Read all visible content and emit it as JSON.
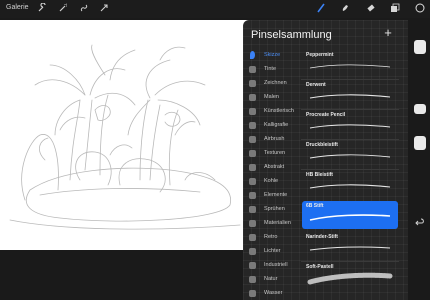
{
  "topbar": {
    "gallery_label": "Galerie",
    "tools": [
      {
        "icon": "wrench-icon"
      },
      {
        "icon": "magic-wand-icon"
      },
      {
        "icon": "selection-icon"
      },
      {
        "icon": "arrow-cursor-icon"
      }
    ],
    "right_tools": [
      {
        "icon": "brush-icon",
        "active": true
      },
      {
        "icon": "smudge-icon"
      },
      {
        "icon": "eraser-icon"
      },
      {
        "icon": "layers-icon"
      },
      {
        "icon": "color-icon"
      }
    ],
    "accent": "#3b82f6"
  },
  "panel": {
    "title": "Pinselsammlung",
    "add_label": "+",
    "categories": [
      {
        "label": "Skizze",
        "active": true
      },
      {
        "label": "Tinte"
      },
      {
        "label": "Zeichnen"
      },
      {
        "label": "Malen"
      },
      {
        "label": "Künstlerisch"
      },
      {
        "label": "Kalligrafie"
      },
      {
        "label": "Airbrush"
      },
      {
        "label": "Texturen"
      },
      {
        "label": "Abstrakt"
      },
      {
        "label": "Kohle"
      },
      {
        "label": "Elemente"
      },
      {
        "label": "Sprühen"
      },
      {
        "label": "Materialien"
      },
      {
        "label": "Retro"
      },
      {
        "label": "Lichter"
      },
      {
        "label": "Industriell"
      },
      {
        "label": "Natur"
      },
      {
        "label": "Wasser"
      }
    ],
    "brushes": [
      {
        "name": "Peppermint"
      },
      {
        "name": "Derwent"
      },
      {
        "name": "Procreate Pencil"
      },
      {
        "name": "Druckbleistift"
      },
      {
        "name": "HB Bleistift"
      },
      {
        "name": "6B Stift",
        "selected": true
      },
      {
        "name": "Narinder-Stift"
      },
      {
        "name": "Soft-Pastell"
      }
    ],
    "selected_color": "#1d6ff2"
  }
}
